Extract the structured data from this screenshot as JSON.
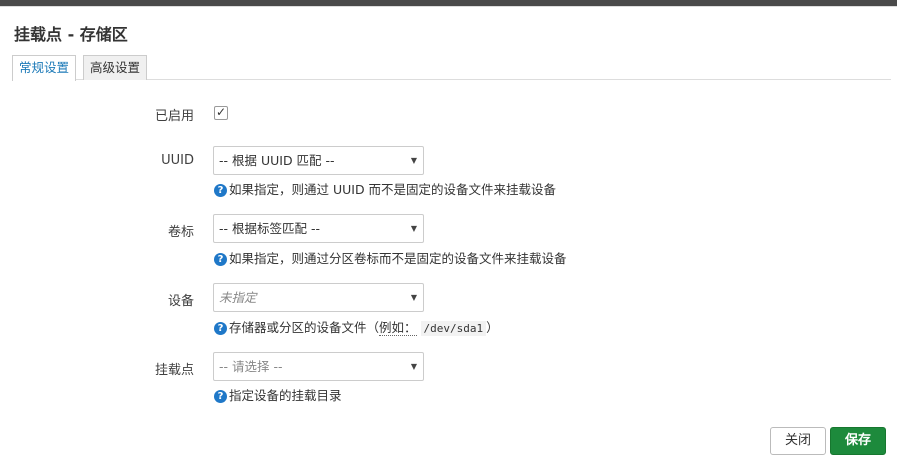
{
  "dialog": {
    "title": "挂载点 - 存储区"
  },
  "tabs": [
    {
      "label": "常规设置"
    },
    {
      "label": "高级设置"
    }
  ],
  "form": {
    "enabled": {
      "label": "已启用",
      "checked": true,
      "check_glyph": "✓"
    },
    "uuid": {
      "label": "UUID",
      "value": "-- 根据 UUID 匹配 --",
      "help": "如果指定，则通过 UUID 而不是固定的设备文件来挂载设备"
    },
    "volume_label": {
      "label": "卷标",
      "value": "-- 根据标签匹配 --",
      "help": "如果指定，则通过分区卷标而不是固定的设备文件来挂载设备"
    },
    "device": {
      "label": "设备",
      "value": "未指定",
      "help_prefix": "存储器或分区的设备文件（",
      "help_example": "例如：",
      "help_code": "/dev/sda1",
      "help_suffix": "）"
    },
    "mount_point": {
      "label": "挂载点",
      "value": "-- 请选择 --",
      "help": "指定设备的挂载目录"
    }
  },
  "icons": {
    "help": "?",
    "caret": "▼"
  },
  "buttons": {
    "close": "关闭",
    "save": "保存"
  },
  "colors": {
    "save_green": "#1d8a3c",
    "help_blue": "#1f78c8",
    "tab_active": "#1c7ab8"
  }
}
